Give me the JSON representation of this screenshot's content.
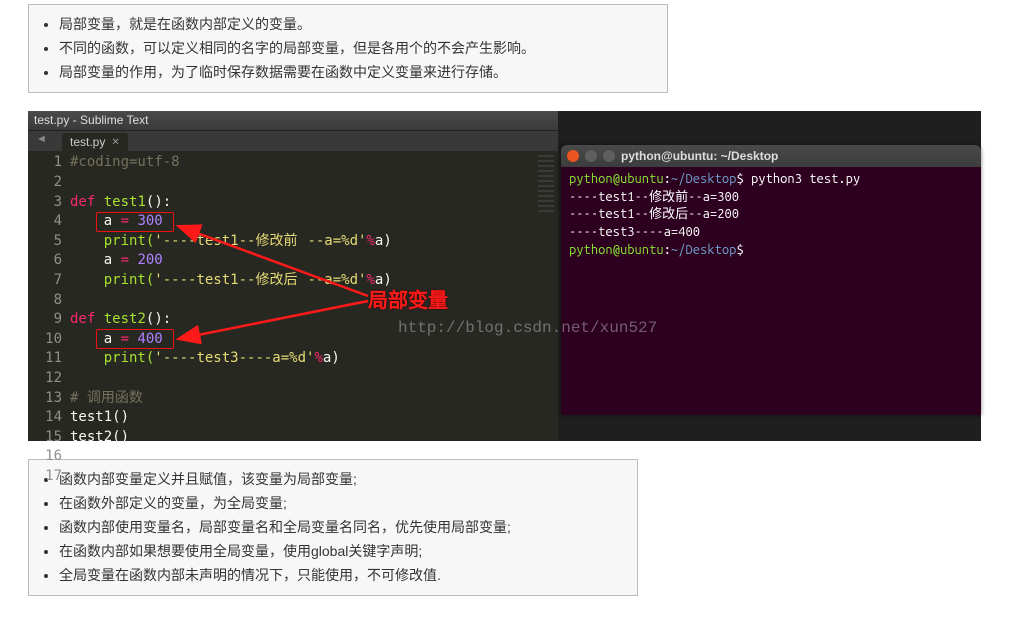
{
  "top_notes": [
    "局部变量，就是在函数内部定义的变量。",
    "不同的函数，可以定义相同的名字的局部变量，但是各用个的不会产生影响。",
    "局部变量的作用，为了临时保存数据需要在函数中定义变量来进行存储。"
  ],
  "bottom_notes": [
    "函数内部变量定义并且赋值，该变量为局部变量;",
    "在函数外部定义的变量，为全局变量;",
    "函数内部使用变量名，局部变量名和全局变量名同名，优先使用局部变量;",
    "在函数内部如果想要使用全局变量，使用global关键字声明;",
    "全局变量在函数内部未声明的情况下，只能使用，不可修改值."
  ],
  "sublime": {
    "window_title": "test.py - Sublime Text",
    "tab_name": "test.py",
    "lines": {
      "1": "#coding=utf-8",
      "2": "",
      "3_def": "def",
      "3_fn": "test1",
      "3_rest": "():",
      "4_var": "a",
      "4_eq": " = ",
      "4_val": "300",
      "5_print_open": "print(",
      "5_str_a": "'----test1--",
      "5_cn_a": "修改前",
      "5_str_b": "--a=%d'",
      "5_pct": "%",
      "5_close": "a)",
      "6_var": "a",
      "6_eq": " = ",
      "6_val": "200",
      "7_print_open": "print(",
      "7_str_a": "'----test1--",
      "7_cn_a": "修改后",
      "7_str_b": "--a=%d'",
      "7_pct": "%",
      "7_close": "a)",
      "8": "",
      "9_def": "def",
      "9_fn": "test2",
      "9_rest": "():",
      "10_var": "a",
      "10_eq": " = ",
      "10_val": "400",
      "11_print_open": "print(",
      "11_str": "'----test3----a=%d'",
      "11_pct": "%",
      "11_close": "a)",
      "12": "",
      "13": "# 调用函数",
      "14": "test1()",
      "15": "test2()"
    },
    "annotation": "局部变量"
  },
  "terminal": {
    "title": "python@ubuntu: ~/Desktop",
    "btn_close_color": "#e95420",
    "btn_min_color": "#5e5e5e",
    "btn_max_color": "#5e5e5e",
    "prompt_user": "python@ubuntu",
    "prompt_sep": ":",
    "prompt_path": "~/Desktop",
    "prompt_end": "$",
    "command": "python3 test.py",
    "output": [
      "----test1--修改前--a=300",
      "----test1--修改后--a=200",
      "----test3----a=400"
    ]
  },
  "watermark": "http://blog.csdn.net/xun527"
}
